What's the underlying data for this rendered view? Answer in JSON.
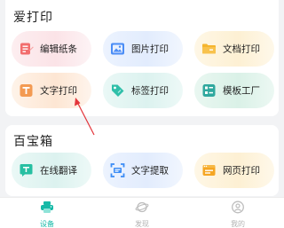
{
  "sections": [
    {
      "title": "爱打印",
      "tiles": [
        {
          "label": "编辑纸条",
          "icon": "edit-note-icon"
        },
        {
          "label": "图片打印",
          "icon": "image-icon"
        },
        {
          "label": "文档打印",
          "icon": "folder-icon"
        },
        {
          "label": "文字打印",
          "icon": "text-icon"
        },
        {
          "label": "标签打印",
          "icon": "tag-icon"
        },
        {
          "label": "模板工厂",
          "icon": "template-icon"
        }
      ]
    },
    {
      "title": "百宝箱",
      "tiles": [
        {
          "label": "在线翻译",
          "icon": "translate-icon"
        },
        {
          "label": "文字提取",
          "icon": "scan-text-icon"
        },
        {
          "label": "网页打印",
          "icon": "web-icon"
        }
      ]
    }
  ],
  "tabs": [
    {
      "label": "设备",
      "icon": "printer-icon",
      "active": true
    },
    {
      "label": "发现",
      "icon": "planet-icon",
      "active": false
    },
    {
      "label": "我的",
      "icon": "profile-icon",
      "active": false
    }
  ],
  "colors": {
    "accent": "#16b9a7",
    "edit_icon": "#f26d6d",
    "image_icon": "#4a8df6",
    "folder_icon": "#f5b52e",
    "text_icon": "#f39a52",
    "tag_icon": "#2fbfa9",
    "template_icon": "#2fa89e",
    "translate_icon": "#27bfa2",
    "scan_icon": "#3b8cf5",
    "web_icon": "#f5a623",
    "annotation_arrow": "#e3353b"
  }
}
